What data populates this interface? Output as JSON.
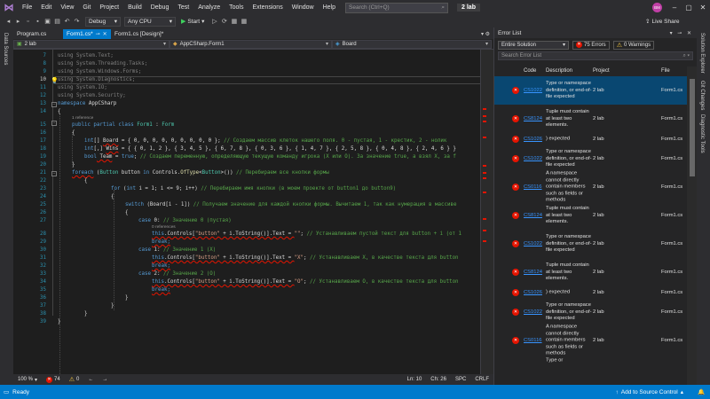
{
  "menu": {
    "items": [
      "File",
      "Edit",
      "View",
      "Git",
      "Project",
      "Build",
      "Debug",
      "Test",
      "Analyze",
      "Tools",
      "Extensions",
      "Window",
      "Help"
    ],
    "search_placeholder": "Search (Ctrl+Q)",
    "solution_name": "2 lab",
    "user_initials": "BM"
  },
  "toolbar": {
    "config": "Debug",
    "platform": "Any CPU",
    "start_label": "Start",
    "live_share": "Live Share"
  },
  "left_strip": {
    "label": "Data Sources"
  },
  "right_strip": {
    "labels": [
      "Solution Explorer",
      "Git Changes",
      "Diagnostic Tools"
    ]
  },
  "tabs": [
    {
      "label": "Program.cs"
    },
    {
      "label": "Form1.cs*"
    },
    {
      "label": "Form1.cs [Design]*"
    }
  ],
  "navbar": {
    "project": "2 lab",
    "class": "AppCSharp.Form1",
    "member": "Board"
  },
  "editor": {
    "line_numbers": [
      "7",
      "8",
      "9",
      "10",
      "11",
      "12",
      "13",
      "14",
      "15",
      "16",
      "17",
      "18",
      "19",
      "20",
      "21",
      "22",
      "23",
      "24",
      "25",
      "26",
      "27",
      "28",
      "29",
      "30",
      "31",
      "32",
      "33",
      "34",
      "35",
      "36",
      "37",
      "38",
      "39"
    ],
    "references_1": "1 reference",
    "references_0": "0 references",
    "lines": {
      "l7": "using System.Text;",
      "l8": "using System.Threading.Tasks;",
      "l9": "using System.Windows.Forms;",
      "l10": "using System.Diagnostics;",
      "l11": "using System.IO;",
      "l12": "using System.Security;",
      "l13a": "namespace",
      "l13b": " AppCSharp",
      "l15a": "public partial class",
      "l15b": " Form1",
      "l15c": " : ",
      "l15d": "Form",
      "l17a": "int",
      "l17b": "[] ",
      "l17c": "Board",
      "l17d": " = { 0, 0, 0, 0, 0, 0, 0, 0, 0 }; ",
      "l17e": "// Создаем массив клеток нашего поля. 0 - пустая, 1 - крестик, 2 - нолик",
      "l18a": "int",
      "l18b": "[,] ",
      "l18c": "Wins",
      "l18d": " = { { 0, 1, 2 }, { 3, 4, 5 }, { 6, 7, 8 }, { 0, 3, 6 }, { 1, 4, 7 }, { 2, 5, 8 }, { 0, 4, 8 }, { 2, 4, 6 } }",
      "l19a": "bool",
      "l19b": " Team",
      "l19c": " = ",
      "l19d": "true",
      "l19e": "; ",
      "l19f": "// Создаем переменную, определяющую текущую команду игрока (X или O). За значение true, а взял X, за f",
      "l21a": "foreach",
      "l21b": " (",
      "l21c": "Button",
      "l21d": " button ",
      "l21e": "in",
      "l21f": " Controls.",
      "l21g": "OfType",
      "l21h": "<",
      "l21i": "Button",
      "l21j": ">()) ",
      "l21k": "// Перебираем все кнопки формы",
      "l23a": "for",
      "l23b": " (",
      "l23c": "int",
      "l23d": " i = 1; i <= 9; i++) ",
      "l23e": "// Перебираем имя кнопки (в моем проекте от button1 до button9)",
      "l25a": "switch",
      "l25b": " (Board[i - 1]) ",
      "l25c": "// Получаем значение для каждой кнопки формы. Вычитаем 1, так как нумерация в массиве",
      "l27a": "case",
      "l27b": " 0: ",
      "l27c": "// Значение 0 (пустая)",
      "l28a": "this",
      "l28b": ".Controls[",
      "l28c": "\"button\"",
      "l28d": " + i.ToString()].Text = ",
      "l28e": "\"\"",
      "l28f": "; ",
      "l28g": "// Устанавливаем пустой текст для button + i (от 1",
      "l29": "break;",
      "l30a": "case",
      "l30b": " 1: ",
      "l30c": "// Значение 1 (X)",
      "l31a": "this",
      "l31b": ".Controls[",
      "l31c": "\"button\"",
      "l31d": " + i.ToString()].Text = ",
      "l31e": "\"X\"",
      "l31f": "; ",
      "l31g": "// Устанавливаем X, в качестве текста для button",
      "l32": "break;",
      "l33a": "case",
      "l33b": " 2: ",
      "l33c": "// Значение 2 (O)",
      "l34a": "this",
      "l34b": ".Controls[",
      "l34c": "\"button\"",
      "l34d": " + i.ToString()].Text = ",
      "l34e": "\"O\"",
      "l34f": "; ",
      "l34g": "// Устанавливаем O, в качестве текста для button",
      "l35": "break;"
    }
  },
  "editor_status": {
    "zoom": "100 %",
    "errors": "74",
    "warnings": "0",
    "line": "Ln: 10",
    "col": "Ch: 26",
    "spc": "SPC",
    "crlf": "CRLF"
  },
  "error_list": {
    "title": "Error List",
    "scope": "Entire Solution",
    "errors_label": "75 Errors",
    "warnings_label": "0 Warnings",
    "search_placeholder": "Search Error List",
    "columns": {
      "code": "Code",
      "description": "Description",
      "project": "Project",
      "file": "File"
    },
    "rows": [
      {
        "code": "CS1022",
        "description": "Type or namespace definition, or end-of-file expected",
        "project": "2 lab",
        "file": "Form1.cs"
      },
      {
        "code": "CS8124",
        "description": "Tuple must contain at least two elements.",
        "project": "2 lab",
        "file": "Form1.cs"
      },
      {
        "code": "CS1026",
        "description": ") expected",
        "project": "2 lab",
        "file": "Form1.cs"
      },
      {
        "code": "CS1022",
        "description": "Type or namespace definition, or end-of-file expected",
        "project": "2 lab",
        "file": "Form1.cs"
      },
      {
        "code": "CS0116",
        "description": "A namespace cannot directly contain members such as fields or methods",
        "project": "2 lab",
        "file": "Form1.cs"
      },
      {
        "code": "CS8124",
        "description": "Tuple must contain at least two elements.",
        "project": "2 lab",
        "file": "Form1.cs"
      },
      {
        "code": "CS1022",
        "description": "Type or namespace definition, or end-of-file expected",
        "project": "2 lab",
        "file": "Form1.cs"
      },
      {
        "code": "CS8124",
        "description": "Tuple must contain at least two elements.",
        "project": "2 lab",
        "file": "Form1.cs"
      },
      {
        "code": "CS1026",
        "description": ") expected",
        "project": "2 lab",
        "file": "Form1.cs"
      },
      {
        "code": "CS1022",
        "description": "Type or namespace definition, or end-of-file expected",
        "project": "2 lab",
        "file": "Form1.cs"
      },
      {
        "code": "CS0116",
        "description": "A namespace cannot directly contain members such as fields or methods",
        "project": "2 lab",
        "file": "Form1.cs"
      },
      {
        "code": "",
        "description": "Type or",
        "project": "",
        "file": ""
      }
    ]
  },
  "status": {
    "ready": "Ready",
    "source_control": "Add to Source Control"
  }
}
